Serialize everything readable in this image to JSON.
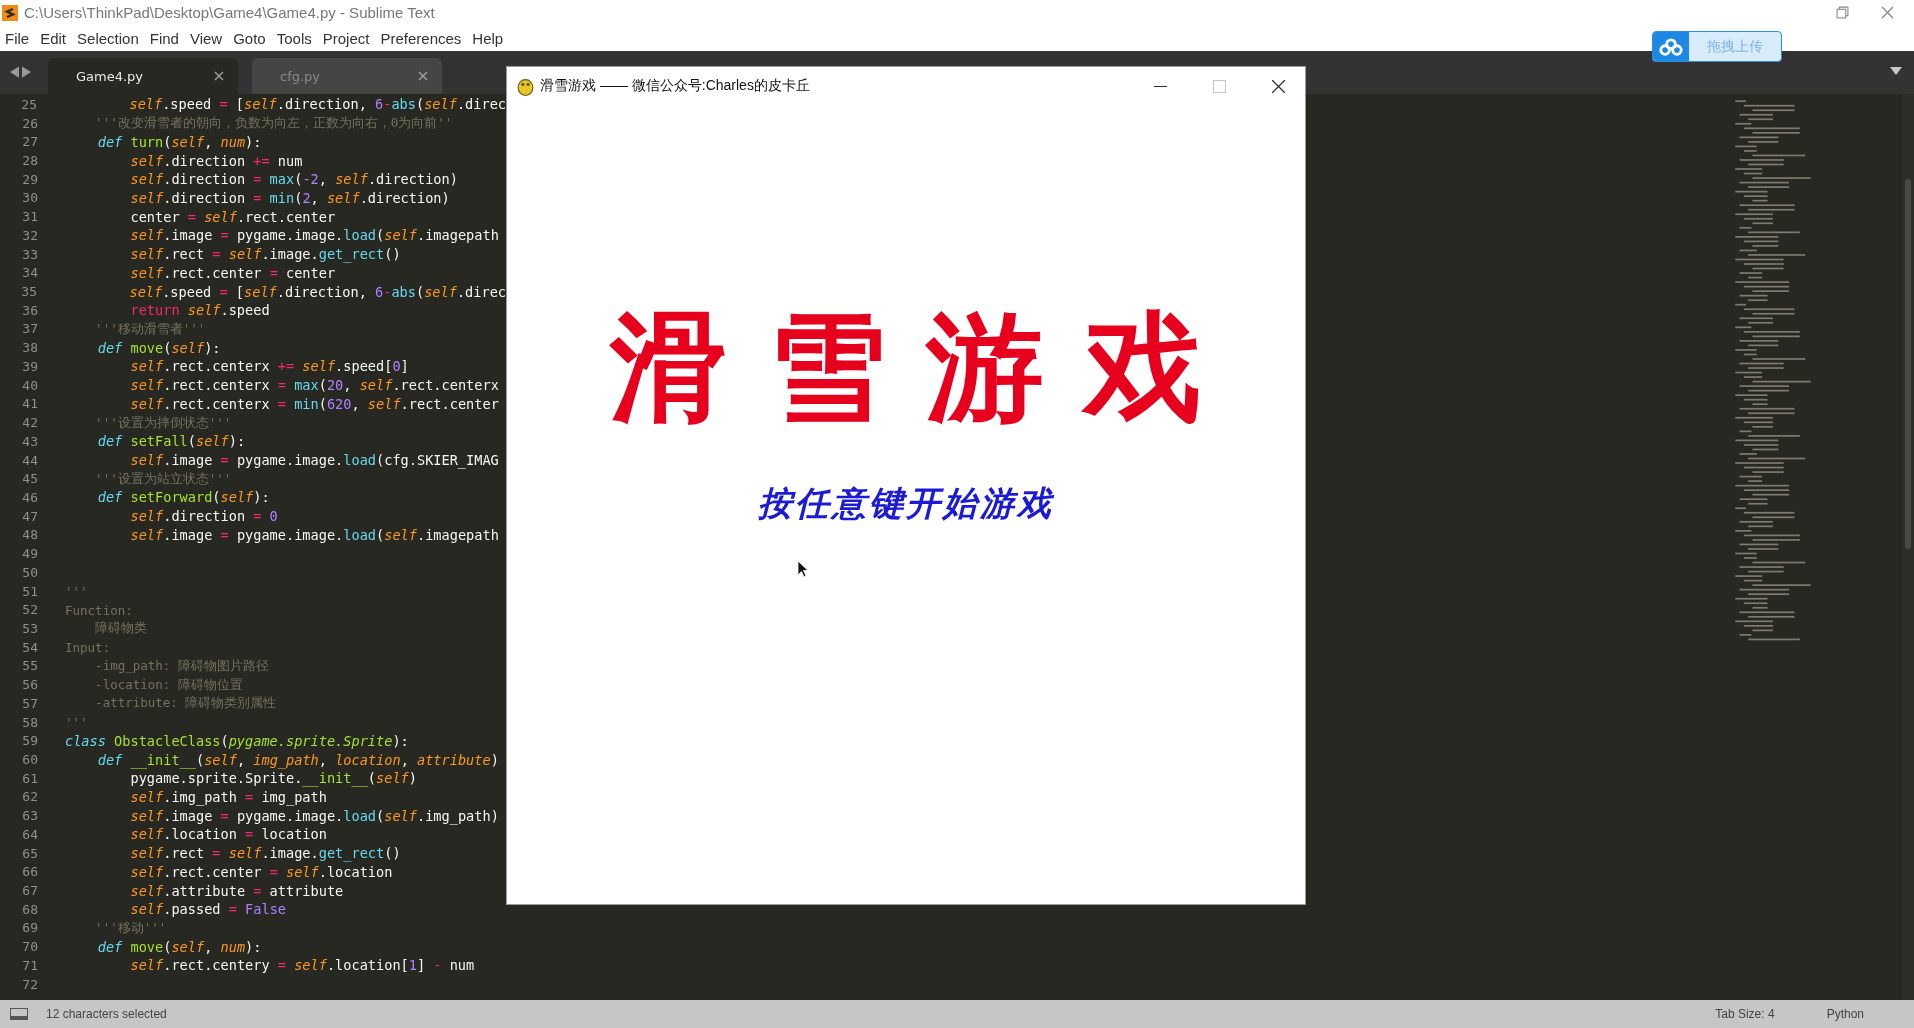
{
  "window": {
    "title": "C:\\Users\\ThinkPad\\Desktop\\Game4\\Game4.py - Sublime Text",
    "menu": [
      "File",
      "Edit",
      "Selection",
      "Find",
      "View",
      "Goto",
      "Tools",
      "Project",
      "Preferences",
      "Help"
    ]
  },
  "upload_button": {
    "label": "拖拽上传"
  },
  "tabs": [
    {
      "label": "Game4.py",
      "selected": true
    },
    {
      "label": "cfg.py",
      "selected": false
    }
  ],
  "editor": {
    "lines": [
      {
        "number": "25",
        "tokens": [
          {
            "kind": "self",
            "text": "        self"
          },
          {
            "kind": "plain",
            "text": ".speed "
          },
          {
            "kind": "op",
            "text": "="
          },
          {
            "kind": "plain",
            "text": " ["
          },
          {
            "kind": "self",
            "text": "self"
          },
          {
            "kind": "plain",
            "text": ".direction, "
          },
          {
            "kind": "num",
            "text": "6"
          },
          {
            "kind": "op",
            "text": "-"
          },
          {
            "kind": "builtin",
            "text": "abs"
          },
          {
            "kind": "plain",
            "text": "("
          },
          {
            "kind": "self",
            "text": "self"
          },
          {
            "kind": "plain",
            "text": ".direc"
          }
        ]
      },
      {
        "number": "26",
        "tokens": [
          {
            "kind": "comment",
            "text": "    '''改变滑雪者的朝向，负数为向左，正数为向右，0为向前''"
          }
        ]
      },
      {
        "number": "27",
        "tokens": [
          {
            "kind": "keyword",
            "text": "    def"
          },
          {
            "kind": "func",
            "text": " turn"
          },
          {
            "kind": "plain",
            "text": "("
          },
          {
            "kind": "self",
            "text": "self"
          },
          {
            "kind": "plain",
            "text": ", "
          },
          {
            "kind": "self",
            "text": "num"
          },
          {
            "kind": "plain",
            "text": "):"
          }
        ]
      },
      {
        "number": "28",
        "tokens": [
          {
            "kind": "self",
            "text": "        self"
          },
          {
            "kind": "plain",
            "text": ".direction "
          },
          {
            "kind": "op",
            "text": "+="
          },
          {
            "kind": "plain",
            "text": " num"
          }
        ]
      },
      {
        "number": "29",
        "tokens": [
          {
            "kind": "self",
            "text": "        self"
          },
          {
            "kind": "plain",
            "text": ".direction "
          },
          {
            "kind": "op",
            "text": "="
          },
          {
            "kind": "builtin",
            "text": " max"
          },
          {
            "kind": "plain",
            "text": "("
          },
          {
            "kind": "num",
            "text": "-2"
          },
          {
            "kind": "plain",
            "text": ", "
          },
          {
            "kind": "self",
            "text": "self"
          },
          {
            "kind": "plain",
            "text": ".direction)"
          }
        ]
      },
      {
        "number": "30",
        "tokens": [
          {
            "kind": "self",
            "text": "        self"
          },
          {
            "kind": "plain",
            "text": ".direction "
          },
          {
            "kind": "op",
            "text": "="
          },
          {
            "kind": "builtin",
            "text": " min"
          },
          {
            "kind": "plain",
            "text": "("
          },
          {
            "kind": "num",
            "text": "2"
          },
          {
            "kind": "plain",
            "text": ", "
          },
          {
            "kind": "self",
            "text": "self"
          },
          {
            "kind": "plain",
            "text": ".direction)"
          }
        ]
      },
      {
        "number": "31",
        "tokens": [
          {
            "kind": "plain",
            "text": "        center "
          },
          {
            "kind": "op",
            "text": "="
          },
          {
            "kind": "self",
            "text": " self"
          },
          {
            "kind": "plain",
            "text": ".rect.center"
          }
        ]
      },
      {
        "number": "32",
        "tokens": [
          {
            "kind": "self",
            "text": "        self"
          },
          {
            "kind": "plain",
            "text": ".image "
          },
          {
            "kind": "op",
            "text": "="
          },
          {
            "kind": "plain",
            "text": " pygame.image."
          },
          {
            "kind": "builtin",
            "text": "load"
          },
          {
            "kind": "plain",
            "text": "("
          },
          {
            "kind": "self",
            "text": "self"
          },
          {
            "kind": "plain",
            "text": ".imagepath"
          }
        ]
      },
      {
        "number": "33",
        "tokens": [
          {
            "kind": "self",
            "text": "        self"
          },
          {
            "kind": "plain",
            "text": ".rect "
          },
          {
            "kind": "op",
            "text": "="
          },
          {
            "kind": "self",
            "text": " self"
          },
          {
            "kind": "plain",
            "text": ".image."
          },
          {
            "kind": "builtin",
            "text": "get_rect"
          },
          {
            "kind": "plain",
            "text": "()"
          }
        ]
      },
      {
        "number": "34",
        "tokens": [
          {
            "kind": "self",
            "text": "        self"
          },
          {
            "kind": "plain",
            "text": ".rect.center "
          },
          {
            "kind": "op",
            "text": "="
          },
          {
            "kind": "plain",
            "text": " center"
          }
        ]
      },
      {
        "number": "35",
        "tokens": [
          {
            "kind": "self",
            "text": "        self"
          },
          {
            "kind": "plain",
            "text": ".speed "
          },
          {
            "kind": "op",
            "text": "="
          },
          {
            "kind": "plain",
            "text": " ["
          },
          {
            "kind": "self",
            "text": "self"
          },
          {
            "kind": "plain",
            "text": ".direction, "
          },
          {
            "kind": "num",
            "text": "6"
          },
          {
            "kind": "op",
            "text": "-"
          },
          {
            "kind": "builtin",
            "text": "abs"
          },
          {
            "kind": "plain",
            "text": "("
          },
          {
            "kind": "self",
            "text": "self"
          },
          {
            "kind": "plain",
            "text": ".direc"
          }
        ]
      },
      {
        "number": "36",
        "tokens": [
          {
            "kind": "return",
            "text": "        return"
          },
          {
            "kind": "self",
            "text": " self"
          },
          {
            "kind": "plain",
            "text": ".speed"
          }
        ]
      },
      {
        "number": "37",
        "tokens": [
          {
            "kind": "comment",
            "text": "    '''移动滑雪者'''"
          }
        ]
      },
      {
        "number": "38",
        "tokens": [
          {
            "kind": "keyword",
            "text": "    def"
          },
          {
            "kind": "func",
            "text": " move"
          },
          {
            "kind": "plain",
            "text": "("
          },
          {
            "kind": "self",
            "text": "self"
          },
          {
            "kind": "plain",
            "text": "):"
          }
        ]
      },
      {
        "number": "39",
        "tokens": [
          {
            "kind": "self",
            "text": "        self"
          },
          {
            "kind": "plain",
            "text": ".rect.centerx "
          },
          {
            "kind": "op",
            "text": "+="
          },
          {
            "kind": "self",
            "text": " self"
          },
          {
            "kind": "plain",
            "text": ".speed["
          },
          {
            "kind": "num",
            "text": "0"
          },
          {
            "kind": "plain",
            "text": "]"
          }
        ]
      },
      {
        "number": "40",
        "tokens": [
          {
            "kind": "self",
            "text": "        self"
          },
          {
            "kind": "plain",
            "text": ".rect.centerx "
          },
          {
            "kind": "op",
            "text": "="
          },
          {
            "kind": "builtin",
            "text": " max"
          },
          {
            "kind": "plain",
            "text": "("
          },
          {
            "kind": "num",
            "text": "20"
          },
          {
            "kind": "plain",
            "text": ", "
          },
          {
            "kind": "self",
            "text": "self"
          },
          {
            "kind": "plain",
            "text": ".rect.centerx"
          }
        ]
      },
      {
        "number": "41",
        "tokens": [
          {
            "kind": "self",
            "text": "        self"
          },
          {
            "kind": "plain",
            "text": ".rect.centerx "
          },
          {
            "kind": "op",
            "text": "="
          },
          {
            "kind": "builtin",
            "text": " min"
          },
          {
            "kind": "plain",
            "text": "("
          },
          {
            "kind": "num",
            "text": "620"
          },
          {
            "kind": "plain",
            "text": ", "
          },
          {
            "kind": "self",
            "text": "self"
          },
          {
            "kind": "plain",
            "text": ".rect.center"
          }
        ]
      },
      {
        "number": "42",
        "tokens": [
          {
            "kind": "comment",
            "text": "    '''设置为摔倒状态'''"
          }
        ]
      },
      {
        "number": "43",
        "tokens": [
          {
            "kind": "keyword",
            "text": "    def"
          },
          {
            "kind": "func",
            "text": " setFall"
          },
          {
            "kind": "plain",
            "text": "("
          },
          {
            "kind": "self",
            "text": "self"
          },
          {
            "kind": "plain",
            "text": "):"
          }
        ]
      },
      {
        "number": "44",
        "tokens": [
          {
            "kind": "self",
            "text": "        self"
          },
          {
            "kind": "plain",
            "text": ".image "
          },
          {
            "kind": "op",
            "text": "="
          },
          {
            "kind": "plain",
            "text": " pygame.image."
          },
          {
            "kind": "builtin",
            "text": "load"
          },
          {
            "kind": "plain",
            "text": "(cfg.SKIER_IMAG"
          }
        ]
      },
      {
        "number": "45",
        "tokens": [
          {
            "kind": "comment",
            "text": "    '''设置为站立状态'''"
          }
        ]
      },
      {
        "number": "46",
        "tokens": [
          {
            "kind": "keyword",
            "text": "    def"
          },
          {
            "kind": "func",
            "text": " setForward"
          },
          {
            "kind": "plain",
            "text": "("
          },
          {
            "kind": "self",
            "text": "self"
          },
          {
            "kind": "plain",
            "text": "):"
          }
        ]
      },
      {
        "number": "47",
        "tokens": [
          {
            "kind": "self",
            "text": "        self"
          },
          {
            "kind": "plain",
            "text": ".direction "
          },
          {
            "kind": "op",
            "text": "="
          },
          {
            "kind": "num",
            "text": " 0"
          }
        ]
      },
      {
        "number": "48",
        "tokens": [
          {
            "kind": "self",
            "text": "        self"
          },
          {
            "kind": "plain",
            "text": ".image "
          },
          {
            "kind": "op",
            "text": "="
          },
          {
            "kind": "plain",
            "text": " pygame.image."
          },
          {
            "kind": "builtin",
            "text": "load"
          },
          {
            "kind": "plain",
            "text": "("
          },
          {
            "kind": "self",
            "text": "self"
          },
          {
            "kind": "plain",
            "text": ".imagepath"
          }
        ]
      },
      {
        "number": "49"
      },
      {
        "number": "50"
      },
      {
        "number": "51",
        "tokens": [
          {
            "kind": "comment",
            "text": "'''"
          }
        ]
      },
      {
        "number": "52",
        "tokens": [
          {
            "kind": "comment",
            "text": "Function:"
          }
        ]
      },
      {
        "number": "53",
        "tokens": [
          {
            "kind": "comment",
            "text": "    障碍物类"
          }
        ]
      },
      {
        "number": "54",
        "tokens": [
          {
            "kind": "comment",
            "text": "Input:"
          }
        ]
      },
      {
        "number": "55",
        "tokens": [
          {
            "kind": "comment",
            "text": "    -img_path: 障碍物图片路径"
          }
        ]
      },
      {
        "number": "56",
        "tokens": [
          {
            "kind": "comment",
            "text": "    -location: 障碍物位置"
          }
        ]
      },
      {
        "number": "57",
        "tokens": [
          {
            "kind": "comment",
            "text": "    -attribute: 障碍物类别属性"
          }
        ]
      },
      {
        "number": "58",
        "tokens": [
          {
            "kind": "comment",
            "text": "'''"
          }
        ]
      },
      {
        "number": "59",
        "tokens": [
          {
            "kind": "keyword",
            "text": "class"
          },
          {
            "kind": "func",
            "text": " ObstacleClass"
          },
          {
            "kind": "plain",
            "text": "("
          },
          {
            "kind": "base",
            "text": "pygame.sprite.Sprite"
          },
          {
            "kind": "plain",
            "text": "):"
          }
        ]
      },
      {
        "number": "60",
        "tokens": [
          {
            "kind": "keyword",
            "text": "    def"
          },
          {
            "kind": "func",
            "text": " __init__"
          },
          {
            "kind": "plain",
            "text": "("
          },
          {
            "kind": "self",
            "text": "self"
          },
          {
            "kind": "plain",
            "text": ", "
          },
          {
            "kind": "self",
            "text": "img_path"
          },
          {
            "kind": "plain",
            "text": ", "
          },
          {
            "kind": "self",
            "text": "location"
          },
          {
            "kind": "plain",
            "text": ", "
          },
          {
            "kind": "self",
            "text": "attribute"
          },
          {
            "kind": "plain",
            "text": ")"
          }
        ]
      },
      {
        "number": "61",
        "tokens": [
          {
            "kind": "plain",
            "text": "        pygame.sprite.Sprite."
          },
          {
            "kind": "func",
            "text": "__init__"
          },
          {
            "kind": "plain",
            "text": "("
          },
          {
            "kind": "self",
            "text": "self"
          },
          {
            "kind": "plain",
            "text": ")"
          }
        ]
      },
      {
        "number": "62",
        "tokens": [
          {
            "kind": "self",
            "text": "        self"
          },
          {
            "kind": "plain",
            "text": ".img_path "
          },
          {
            "kind": "op",
            "text": "="
          },
          {
            "kind": "plain",
            "text": " img_path"
          }
        ]
      },
      {
        "number": "63",
        "tokens": [
          {
            "kind": "self",
            "text": "        self"
          },
          {
            "kind": "plain",
            "text": ".image "
          },
          {
            "kind": "op",
            "text": "="
          },
          {
            "kind": "plain",
            "text": " pygame.image."
          },
          {
            "kind": "builtin",
            "text": "load"
          },
          {
            "kind": "plain",
            "text": "("
          },
          {
            "kind": "self",
            "text": "self"
          },
          {
            "kind": "plain",
            "text": ".img_path)"
          }
        ]
      },
      {
        "number": "64",
        "tokens": [
          {
            "kind": "self",
            "text": "        self"
          },
          {
            "kind": "plain",
            "text": ".location "
          },
          {
            "kind": "op",
            "text": "="
          },
          {
            "kind": "plain",
            "text": " location"
          }
        ]
      },
      {
        "number": "65",
        "tokens": [
          {
            "kind": "self",
            "text": "        self"
          },
          {
            "kind": "plain",
            "text": ".rect "
          },
          {
            "kind": "op",
            "text": "="
          },
          {
            "kind": "self",
            "text": " self"
          },
          {
            "kind": "plain",
            "text": ".image."
          },
          {
            "kind": "builtin",
            "text": "get_rect"
          },
          {
            "kind": "plain",
            "text": "()"
          }
        ]
      },
      {
        "number": "66",
        "tokens": [
          {
            "kind": "self",
            "text": "        self"
          },
          {
            "kind": "plain",
            "text": ".rect.center "
          },
          {
            "kind": "op",
            "text": "="
          },
          {
            "kind": "self",
            "text": " self"
          },
          {
            "kind": "plain",
            "text": ".location"
          }
        ]
      },
      {
        "number": "67",
        "tokens": [
          {
            "kind": "self",
            "text": "        self"
          },
          {
            "kind": "plain",
            "text": ".attribute "
          },
          {
            "kind": "op",
            "text": "="
          },
          {
            "kind": "plain",
            "text": " attribute"
          }
        ]
      },
      {
        "number": "68",
        "tokens": [
          {
            "kind": "self",
            "text": "        self"
          },
          {
            "kind": "plain",
            "text": ".passed "
          },
          {
            "kind": "op",
            "text": "="
          },
          {
            "kind": "num",
            "text": " False"
          }
        ]
      },
      {
        "number": "69",
        "tokens": [
          {
            "kind": "comment",
            "text": "    '''移动'''"
          }
        ]
      },
      {
        "number": "70",
        "tokens": [
          {
            "kind": "keyword",
            "text": "    def"
          },
          {
            "kind": "func",
            "text": " move"
          },
          {
            "kind": "plain",
            "text": "("
          },
          {
            "kind": "self",
            "text": "self"
          },
          {
            "kind": "plain",
            "text": ", "
          },
          {
            "kind": "self",
            "text": "num"
          },
          {
            "kind": "plain",
            "text": "):"
          }
        ]
      },
      {
        "number": "71",
        "tokens": [
          {
            "kind": "self",
            "text": "        self"
          },
          {
            "kind": "plain",
            "text": ".rect.centery "
          },
          {
            "kind": "op",
            "text": "="
          },
          {
            "kind": "self",
            "text": " self"
          },
          {
            "kind": "plain",
            "text": ".location["
          },
          {
            "kind": "num",
            "text": "1"
          },
          {
            "kind": "plain",
            "text": "] "
          },
          {
            "kind": "op",
            "text": "-"
          },
          {
            "kind": "plain",
            "text": " num"
          }
        ]
      },
      {
        "number": "72"
      }
    ]
  },
  "game_window": {
    "title": "滑雪游戏 —— 微信公众号:Charles的皮卡丘",
    "heading": "滑雪游戏",
    "prompt": "按任意键开始游戏"
  },
  "status_bar": {
    "selection": "12 characters selected",
    "tab_size": "Tab Size: 4",
    "syntax": "Python"
  }
}
